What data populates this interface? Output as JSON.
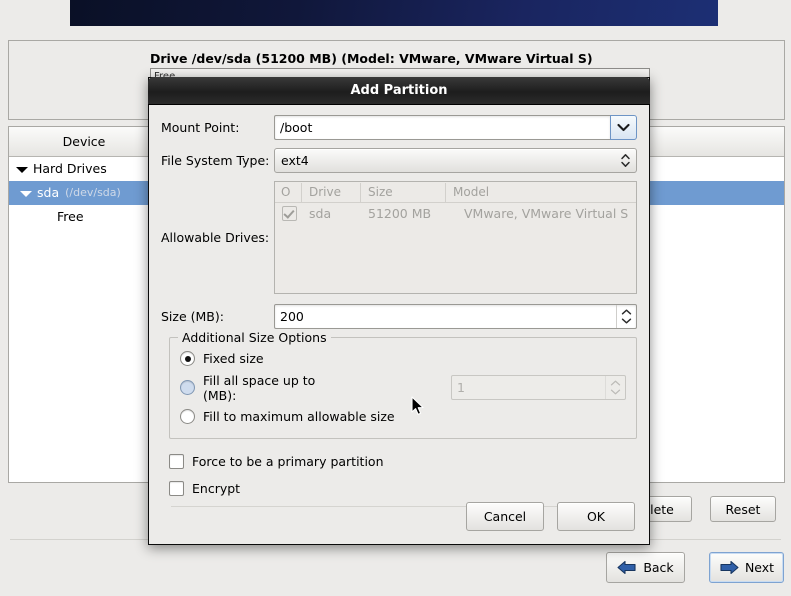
{
  "background": {
    "drive_panel": {
      "drive_label": "Drive /dev/sda (51200 MB) (Model: VMware, VMware Virtual S)",
      "bar_segment_label": "Free"
    },
    "tree": {
      "column_header": "Device",
      "rows": [
        {
          "label": "Hard Drives",
          "path": ""
        },
        {
          "label": "sda",
          "path": "(/dev/sda)"
        },
        {
          "label": "Free",
          "path": ""
        }
      ]
    },
    "buttons": {
      "delete": "lete",
      "reset": "Reset",
      "back": "Back",
      "next": "Next"
    }
  },
  "dialog": {
    "title": "Add Partition",
    "mount_point": {
      "label": "Mount Point:",
      "value": "/boot",
      "dropdown_icon": "chevron-down-icon"
    },
    "file_system_type": {
      "label": "File System Type:",
      "value": "ext4",
      "icon": "up-down-arrows-icon"
    },
    "allowable_drives": {
      "label": "Allowable Drives:",
      "columns": [
        "O",
        "Drive",
        "Size",
        "Model"
      ],
      "rows": [
        {
          "checked": true,
          "drive": "sda",
          "size": "51200 MB",
          "model": "VMware, VMware Virtual S"
        }
      ]
    },
    "size": {
      "label": "Size (MB):",
      "value": "200"
    },
    "additional_size_options": {
      "legend": "Additional Size Options",
      "options": [
        {
          "label": "Fixed size",
          "selected": true,
          "hover": false
        },
        {
          "label": "Fill all space up to (MB):",
          "selected": false,
          "hover": true
        },
        {
          "label": "Fill to maximum allowable size",
          "selected": false,
          "hover": false
        }
      ],
      "fill_up_to_value": "1"
    },
    "checkboxes": [
      {
        "label": "Force to be a primary partition",
        "checked": false
      },
      {
        "label": "Encrypt",
        "checked": false
      }
    ],
    "actions": {
      "cancel": "Cancel",
      "ok": "OK"
    }
  },
  "colors": {
    "selection_blue": "#6f9bd1",
    "banner_dark": "#0a1026",
    "banner_light": "#1c2f74",
    "accent_arrow": "#2a5699",
    "window_bg": "#ecebe9"
  }
}
